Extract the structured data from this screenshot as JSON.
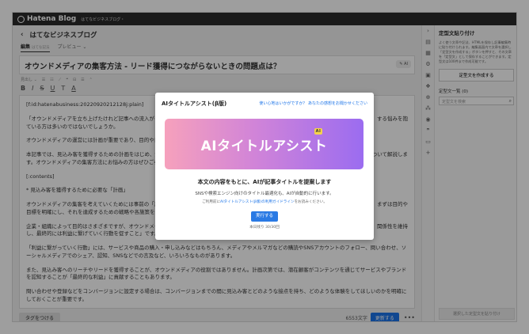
{
  "topbar": {
    "brand": "Hatena Blog",
    "blog_name": "はてなビジネスブログ・"
  },
  "editor": {
    "back_label": "‹",
    "blog_title": "はてなビジネスブログ",
    "tabs": [
      {
        "label": "編集",
        "sub": "はてな記法"
      },
      {
        "label": "プレビュー ⌄"
      }
    ],
    "title_value": "オウンドメディアの集客方法 - リード獲得につながらないときの問題点は？",
    "title_ai_button": "✎ AI",
    "toolbar_row1": [
      "見出し ⌄",
      "☰",
      "☷",
      "⟋",
      "❝",
      "⊟",
      "☰",
      "⌃"
    ],
    "toolbar_row2": [
      "B",
      "I",
      "S",
      "U",
      "T",
      "A"
    ],
    "body_lines": [
      "[f:id:hatenabusiness:20220920212128j:plain]",
      "「オウンドメディアを立ち上げたけれど記事への流入が",
      "ている方は多いのではないでしょうか。",
      "オウンドメディアの運営には計画が重要であり、目的や目",
      "本記事では、見込み客を獲得するための計画をはじめ、鈴",
      "す。オウンドメディアの集客方法にお悩みの方はぜひご参考",
      "[:contents]",
      "* 見込み客を獲得するために必要な「計画」",
      "オウンドメディアの集客を考えていくためには事前の「計",
      "目標を明確にし、それを達成するための戦略や各施策を",
      "企業・組織によって目的はさまざまですが、オウンドメデ",
      "し、最終的には利益に繋げていく行動を促すこと」です。",
      "「利益に繋がっていく行動」には、サービスや商品の購入・申し込みなどはもちろん、メディアやメルマガなどの購読やSNSアカウントのフォロー、問い合わせ、ソーシャルメディアでのシェア、認知、SNSなどでの言及など、いろいろなものがあります。",
      "また、見込み客へのリーチやリードを獲得することが、オウンドメディアの役割ではありません。計画次第では、潜在顧客がコンテンツを通じてサービスやブランドを認知することが「最終的な利益」に貢献することもあります。",
      "問い合わせや登録などをコンバージョンに設定する場合は、コンバージョンまでの間に見込み客とどのような接点を持ち、どのような体験をしてほしいのかを明確にしておくことが重要です。"
    ],
    "right_snippets": [
      "する悩みを抱",
      "ついて解説しま",
      "、まずは目的や",
      "関係性を維持"
    ],
    "tag_button": "タグをつける",
    "char_count": "6553文字",
    "update_button": "更新する",
    "more_button": "•••"
  },
  "icon_rail": [
    "›",
    "▤",
    "▦",
    "⚙",
    "▣",
    "❖",
    "⊕",
    "⁂",
    "◉",
    "❞",
    "▭",
    "+"
  ],
  "panel": {
    "title": "定型文貼り付け",
    "description": "よく使う文章や記法、HTMLを保存し記事編集時に貼り付けられます。編集画面内で文章を選択し「定型文を作成する」ボタンを押すと、その文章を「定型文」として保存することができます。定型文は100件まで作成可能です。",
    "create_button": "定型文を作成する",
    "list_header": "定型文一覧 (0)",
    "search_placeholder": "定型文を検索",
    "paste_button": "選択した定型文を貼り付け"
  },
  "modal": {
    "title": "AIタイトルアシスト(β版)",
    "feedback_link": "使い心地はいかがですか？ あなたの感想をお聞かせください",
    "close": "×",
    "banner_title": "AIタイトルアシスト",
    "banner_badge": "AI",
    "lead": "本文の内容をもとに、AIが記事タイトルを提案します",
    "sub": "SNSや検索エンジン向けのタイトル最適化も、AIが自動的に行います。",
    "notice_prefix": "ご利用前に",
    "notice_link": "AIタイトルアシスト(β版)の利用ガイドライン",
    "notice_suffix": "をお読みください。",
    "run_button": "実行する",
    "remaining": "本日残り 30/30回"
  },
  "colors": {
    "accent": "#2a7ae4",
    "topbar": "#2b2b2b",
    "banner_start": "#f6a1bc",
    "banner_end": "#9b6cf0"
  }
}
